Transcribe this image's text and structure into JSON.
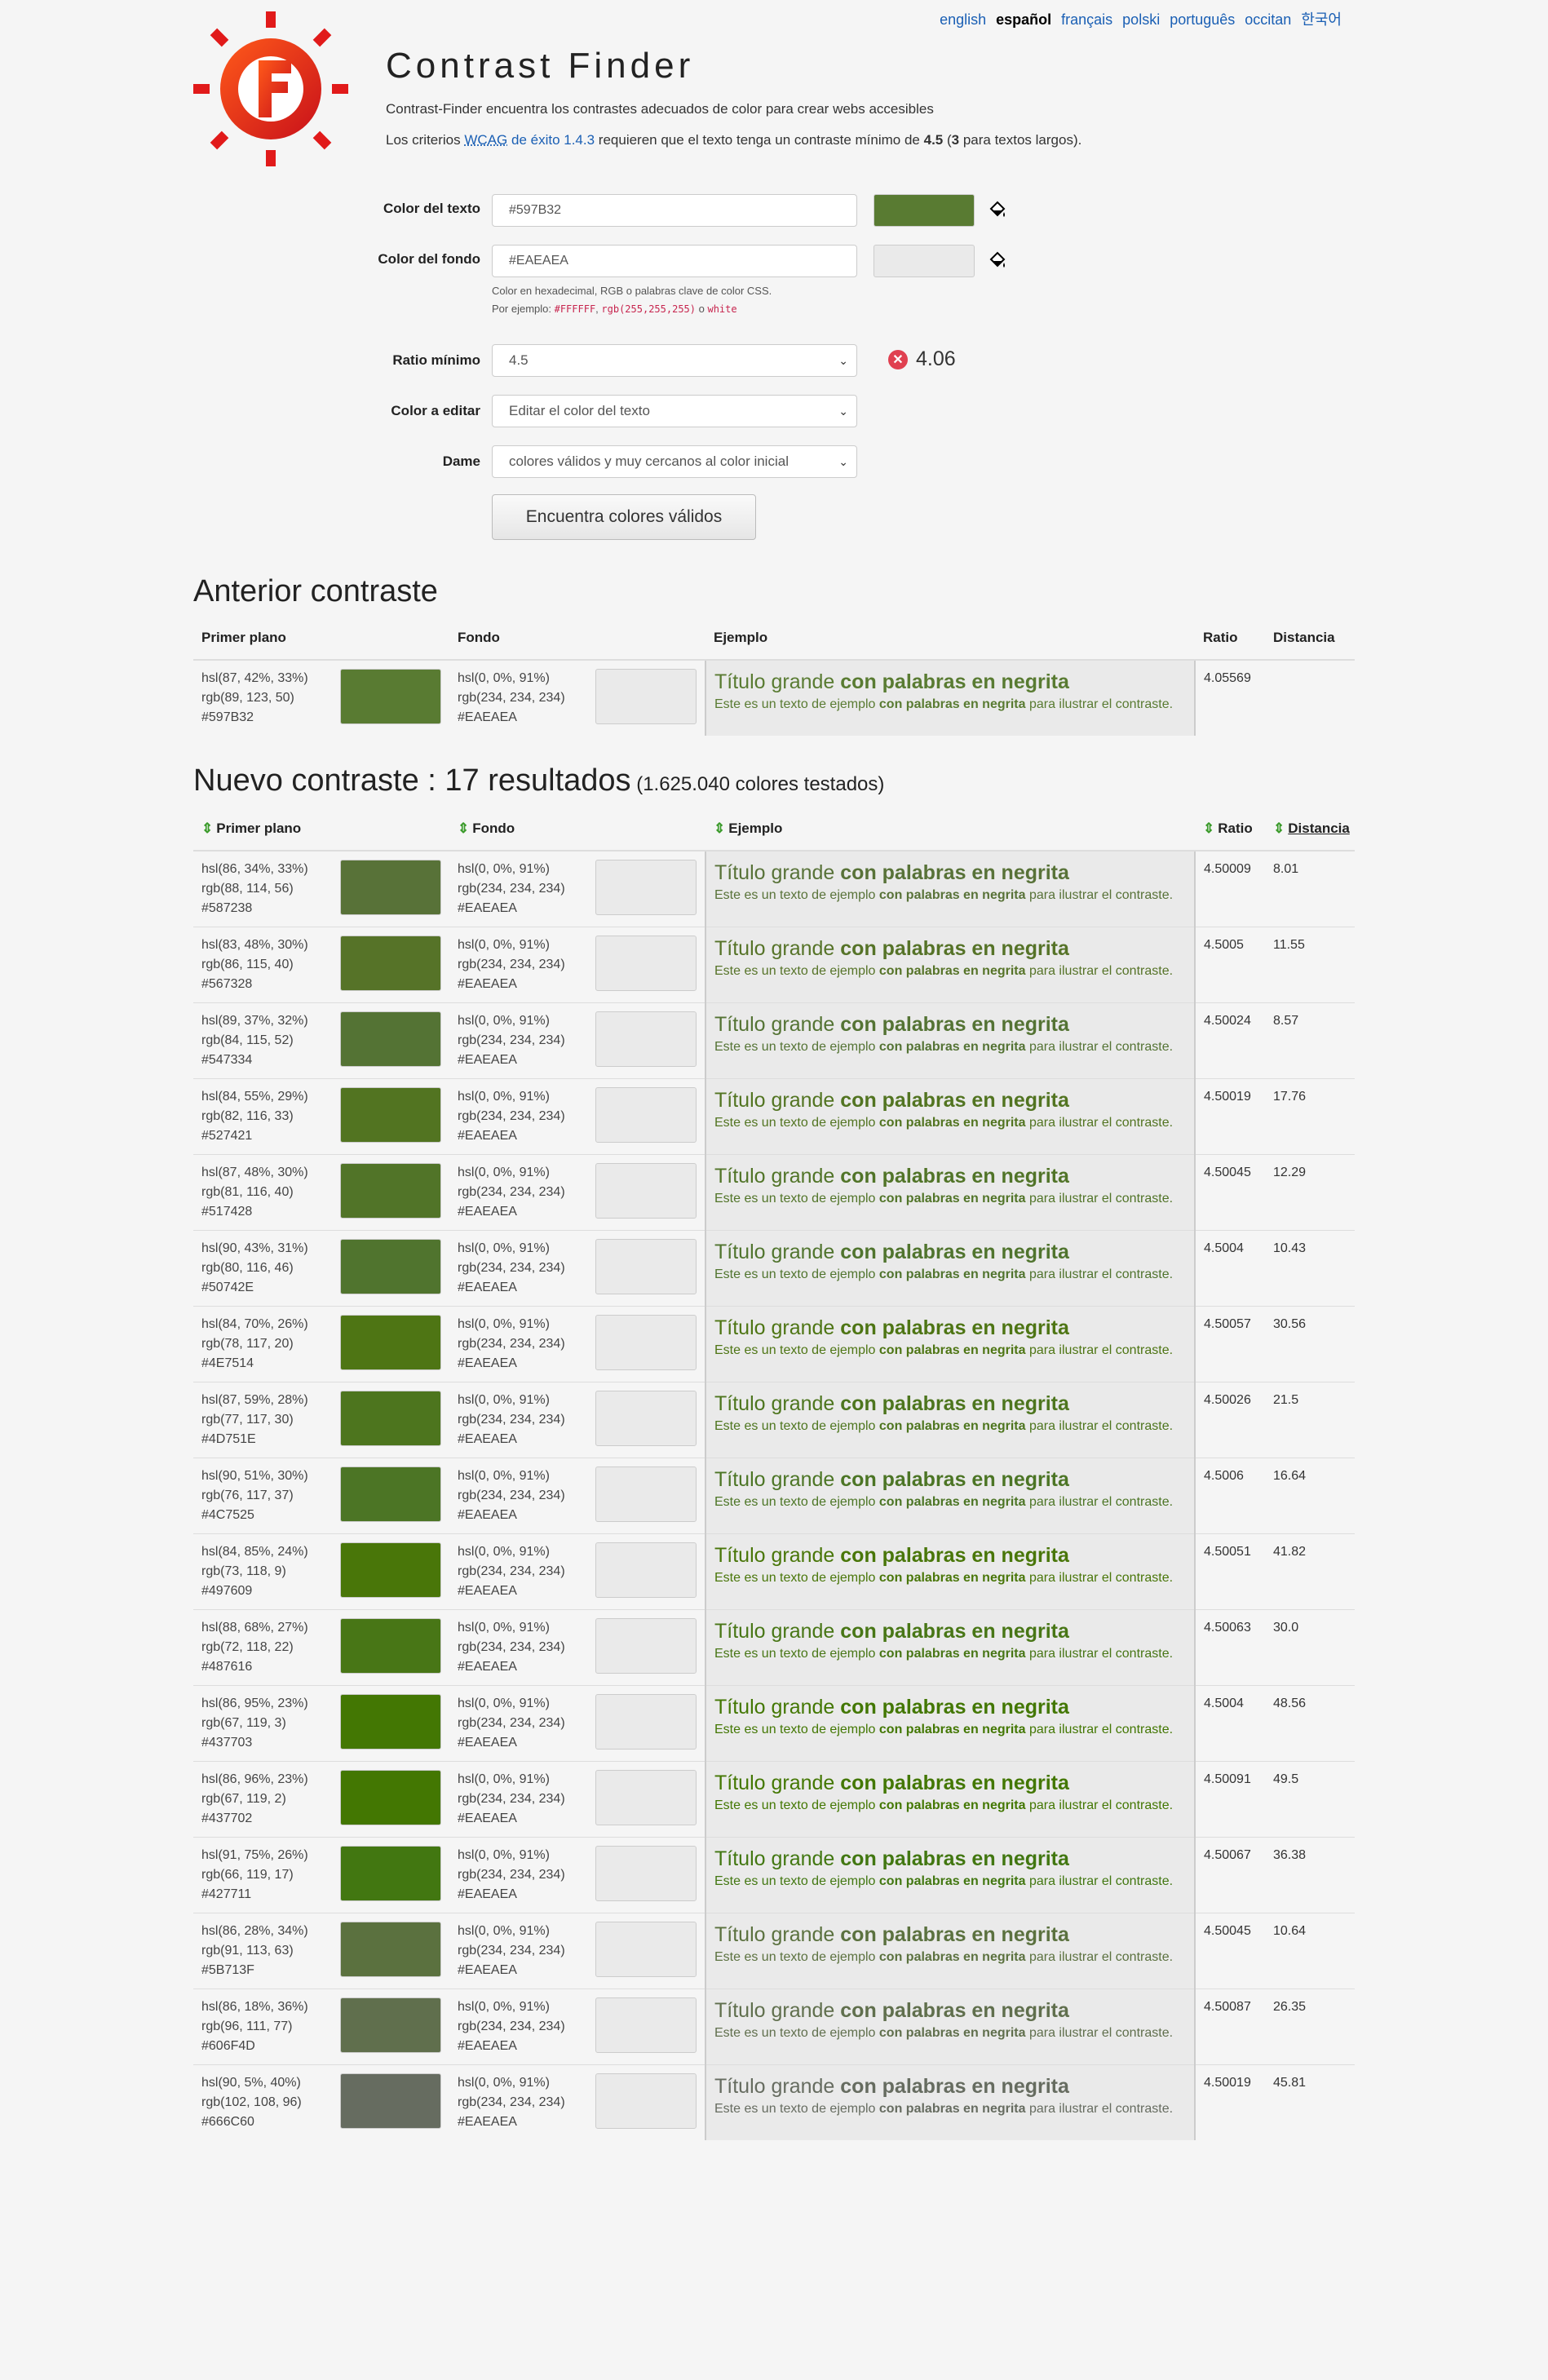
{
  "languages": [
    {
      "label": "english",
      "active": false
    },
    {
      "label": "español",
      "active": true
    },
    {
      "label": "français",
      "active": false
    },
    {
      "label": "polski",
      "active": false
    },
    {
      "label": "português",
      "active": false
    },
    {
      "label": "occitan",
      "active": false
    },
    {
      "label": "한국어",
      "active": false
    }
  ],
  "header": {
    "title": "Contrast Finder",
    "tagline": "Contrast-Finder encuentra los contrastes adecuados de color para crear webs accesibles",
    "wcag_prefix": "Los criterios ",
    "wcag_abbr": "WCAG",
    "wcag_link": " de éxito 1.4.3",
    "wcag_mid": " requieren que el texto tenga un contraste mínimo de ",
    "wcag_min": "4.5",
    "wcag_open": " (",
    "wcag_large": "3",
    "wcag_end": " para textos largos)."
  },
  "form": {
    "text_color_label": "Color del texto",
    "text_color_value": "#597B32",
    "bg_color_label": "Color del fondo",
    "bg_color_value": "#EAEAEA",
    "hint_line1": "Color en hexadecimal, RGB o palabras clave de color CSS.",
    "hint_prefix": "Por ejemplo: ",
    "hint_ex1": "#FFFFFF",
    "hint_sep": ", ",
    "hint_ex2": "rgb(255,255,255)",
    "hint_or": " o ",
    "hint_ex3": "white",
    "ratio_label": "Ratio mínimo",
    "ratio_value": "4.5",
    "current_ratio": "4.06",
    "edit_label": "Color a editar",
    "edit_value": "Editar el color del texto",
    "give_label": "Dame",
    "give_value": "colores válidos y muy cercanos al color inicial",
    "submit": "Encuentra colores válidos"
  },
  "colors": {
    "text": "#597B32",
    "background": "#EAEAEA",
    "error": "#e04050",
    "link": "#1a5fb4"
  },
  "columns": {
    "fg": "Primer plano",
    "bg": "Fondo",
    "example": "Ejemplo",
    "ratio": "Ratio",
    "distance": "Distancia"
  },
  "example": {
    "big_normal": "Título grande ",
    "big_bold": "con palabras en negrita",
    "small_1": "Este es un texto de ejemplo ",
    "small_bold": "con palabras en negrita",
    "small_2": " para ilustrar el contraste."
  },
  "previous": {
    "heading": "Anterior contraste",
    "row": {
      "hsl": "hsl(87, 42%, 33%)",
      "rgb": "rgb(89, 123, 50)",
      "hex": "#597B32",
      "bg_hsl": "hsl(0, 0%, 91%)",
      "bg_rgb": "rgb(234, 234, 234)",
      "bg_hex": "#EAEAEA",
      "ratio": "4.05569",
      "distance": ""
    }
  },
  "results": {
    "heading_main": "Nuevo contraste : 17 resultados",
    "heading_sub": " (1.625.040 colores testados)",
    "bg": {
      "hsl": "hsl(0, 0%, 91%)",
      "rgb": "rgb(234, 234, 234)",
      "hex": "#EAEAEA"
    },
    "rows": [
      {
        "hsl": "hsl(86, 34%, 33%)",
        "rgb": "rgb(88, 114, 56)",
        "hex": "#587238",
        "ratio": "4.50009",
        "distance": "8.01"
      },
      {
        "hsl": "hsl(83, 48%, 30%)",
        "rgb": "rgb(86, 115, 40)",
        "hex": "#567328",
        "ratio": "4.5005",
        "distance": "11.55"
      },
      {
        "hsl": "hsl(89, 37%, 32%)",
        "rgb": "rgb(84, 115, 52)",
        "hex": "#547334",
        "ratio": "4.50024",
        "distance": "8.57"
      },
      {
        "hsl": "hsl(84, 55%, 29%)",
        "rgb": "rgb(82, 116, 33)",
        "hex": "#527421",
        "ratio": "4.50019",
        "distance": "17.76"
      },
      {
        "hsl": "hsl(87, 48%, 30%)",
        "rgb": "rgb(81, 116, 40)",
        "hex": "#517428",
        "ratio": "4.50045",
        "distance": "12.29"
      },
      {
        "hsl": "hsl(90, 43%, 31%)",
        "rgb": "rgb(80, 116, 46)",
        "hex": "#50742E",
        "ratio": "4.5004",
        "distance": "10.43"
      },
      {
        "hsl": "hsl(84, 70%, 26%)",
        "rgb": "rgb(78, 117, 20)",
        "hex": "#4E7514",
        "ratio": "4.50057",
        "distance": "30.56"
      },
      {
        "hsl": "hsl(87, 59%, 28%)",
        "rgb": "rgb(77, 117, 30)",
        "hex": "#4D751E",
        "ratio": "4.50026",
        "distance": "21.5"
      },
      {
        "hsl": "hsl(90, 51%, 30%)",
        "rgb": "rgb(76, 117, 37)",
        "hex": "#4C7525",
        "ratio": "4.5006",
        "distance": "16.64"
      },
      {
        "hsl": "hsl(84, 85%, 24%)",
        "rgb": "rgb(73, 118, 9)",
        "hex": "#497609",
        "ratio": "4.50051",
        "distance": "41.82"
      },
      {
        "hsl": "hsl(88, 68%, 27%)",
        "rgb": "rgb(72, 118, 22)",
        "hex": "#487616",
        "ratio": "4.50063",
        "distance": "30.0"
      },
      {
        "hsl": "hsl(86, 95%, 23%)",
        "rgb": "rgb(67, 119, 3)",
        "hex": "#437703",
        "ratio": "4.5004",
        "distance": "48.56"
      },
      {
        "hsl": "hsl(86, 96%, 23%)",
        "rgb": "rgb(67, 119, 2)",
        "hex": "#437702",
        "ratio": "4.50091",
        "distance": "49.5"
      },
      {
        "hsl": "hsl(91, 75%, 26%)",
        "rgb": "rgb(66, 119, 17)",
        "hex": "#427711",
        "ratio": "4.50067",
        "distance": "36.38"
      },
      {
        "hsl": "hsl(86, 28%, 34%)",
        "rgb": "rgb(91, 113, 63)",
        "hex": "#5B713F",
        "ratio": "4.50045",
        "distance": "10.64"
      },
      {
        "hsl": "hsl(86, 18%, 36%)",
        "rgb": "rgb(96, 111, 77)",
        "hex": "#606F4D",
        "ratio": "4.50087",
        "distance": "26.35"
      },
      {
        "hsl": "hsl(90, 5%, 40%)",
        "rgb": "rgb(102, 108, 96)",
        "hex": "#666C60",
        "ratio": "4.50019",
        "distance": "45.81"
      }
    ]
  }
}
